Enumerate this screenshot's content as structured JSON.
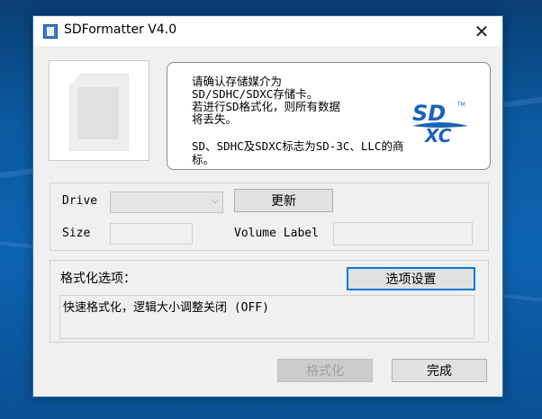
{
  "window": {
    "title": "SDFormatter V4.0"
  },
  "info": {
    "lines1": [
      "请确认存储媒介为",
      "SD/SDHC/SDXC存储卡。",
      "若进行SD格式化，则所有数据",
      "将丢失。"
    ],
    "lines2": [
      "SD、SDHC及SDXC标志为SD-3C、LLC的商",
      "标。"
    ],
    "logo_text_top": "SD",
    "logo_text_bottom": "XC",
    "logo_tm": "TM"
  },
  "drive": {
    "drive_label": "Drive",
    "refresh_label": "更新",
    "size_label": "Size",
    "volume_label": "Volume Label"
  },
  "options": {
    "group_label": "格式化选项：",
    "settings_label": "选项设置",
    "current_option": "快速格式化，逻辑大小调整关闭 (OFF)"
  },
  "actions": {
    "format_label": "格式化",
    "done_label": "完成"
  },
  "colors": {
    "sd_logo": "#1b63b6",
    "focus": "#0078d7"
  }
}
